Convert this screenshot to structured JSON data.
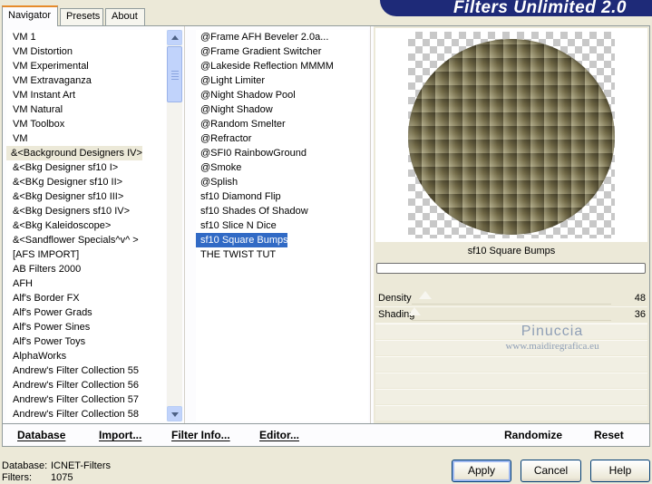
{
  "app": {
    "title": "Filters Unlimited 2.0",
    "colors": {
      "accent": "#e68b2c",
      "selection": "#316ac5",
      "banner": "#1e2a78",
      "preview_texture": "#7d744d"
    }
  },
  "tabs": [
    {
      "label": "Navigator",
      "active": true
    },
    {
      "label": "Presets",
      "active": false
    },
    {
      "label": "About",
      "active": false
    }
  ],
  "categories": {
    "selected_label": "&<Background Designers IV>",
    "items": [
      "VM 1",
      "VM Distortion",
      "VM Experimental",
      "VM Extravaganza",
      "VM Instant Art",
      "VM Natural",
      "VM Toolbox",
      "VM",
      "&<Background Designers IV>",
      "&<Bkg Designer sf10 I>",
      "&<BKg Designer sf10 II>",
      "&<Bkg Designer sf10 III>",
      "&<Bkg Designers sf10 IV>",
      "&<Bkg Kaleidoscope>",
      "&<Sandflower Specials^v^ >",
      "[AFS IMPORT]",
      "AB Filters 2000",
      "AFH",
      "Alf's Border FX",
      "Alf's Power Grads",
      "Alf's Power Sines",
      "Alf's Power Toys",
      "AlphaWorks",
      "Andrew's Filter Collection 55",
      "Andrew's Filter Collection 56",
      "Andrew's Filter Collection 57",
      "Andrew's Filter Collection 58"
    ]
  },
  "filters": {
    "selected_label": "sf10 Square Bumps",
    "items": [
      "@Frame AFH Beveler 2.0a...",
      "@Frame Gradient Switcher",
      "@Lakeside Reflection MMMM",
      "@Light Limiter",
      "@Night Shadow Pool",
      "@Night Shadow",
      "@Random Smelter",
      "@Refractor",
      "@SFI0 RainbowGround",
      "@Smoke",
      "@Splish",
      "sf10 Diamond Flip",
      "sf10 Shades Of Shadow",
      "sf10 Slice N Dice",
      "sf10 Square Bumps",
      "THE TWIST TUT"
    ]
  },
  "preview": {
    "filter_name": "sf10 Square Bumps",
    "progress": 0
  },
  "params": [
    {
      "label": "Density",
      "value": "48"
    },
    {
      "label": "Shading",
      "value": "36"
    }
  ],
  "watermark": {
    "name": "Pinuccia",
    "url": "www.maidiregrafica.eu"
  },
  "toolbar": {
    "database": "Database",
    "import": "Import...",
    "filter_info": "Filter Info...",
    "editor": "Editor...",
    "randomize": "Randomize",
    "reset": "Reset"
  },
  "status": {
    "database_label": "Database:",
    "database_value": "ICNET-Filters",
    "filters_label": "Filters:",
    "filters_value": "1075"
  },
  "buttons": {
    "apply": "Apply",
    "cancel": "Cancel",
    "help": "Help"
  }
}
